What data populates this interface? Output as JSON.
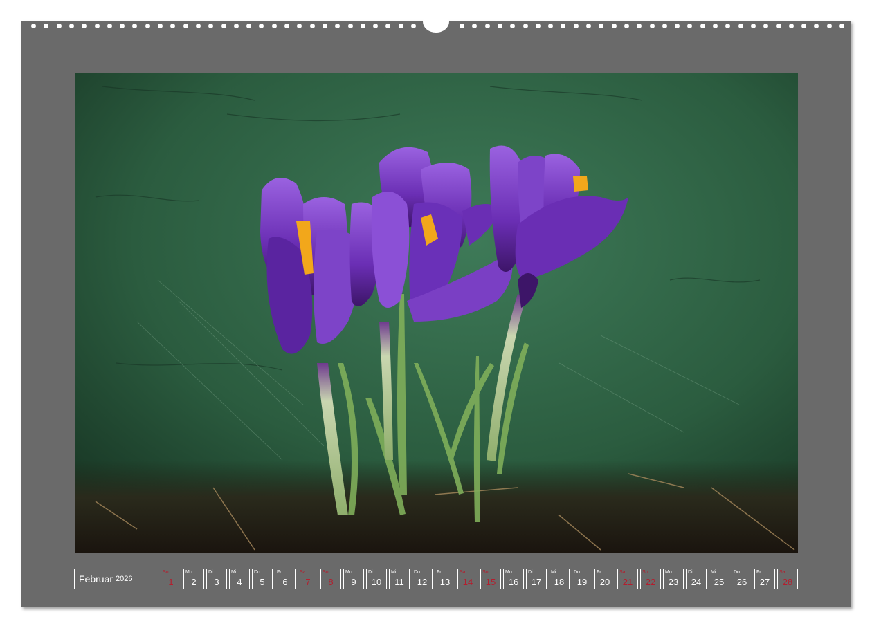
{
  "calendar": {
    "month": "Februar",
    "year": "2026",
    "days": [
      {
        "dow": "So",
        "num": "1",
        "weekend": true
      },
      {
        "dow": "Mo",
        "num": "2",
        "weekend": false
      },
      {
        "dow": "Di",
        "num": "3",
        "weekend": false
      },
      {
        "dow": "Mi",
        "num": "4",
        "weekend": false
      },
      {
        "dow": "Do",
        "num": "5",
        "weekend": false
      },
      {
        "dow": "Fr",
        "num": "6",
        "weekend": false
      },
      {
        "dow": "Sa",
        "num": "7",
        "weekend": true
      },
      {
        "dow": "So",
        "num": "8",
        "weekend": true
      },
      {
        "dow": "Mo",
        "num": "9",
        "weekend": false
      },
      {
        "dow": "Di",
        "num": "10",
        "weekend": false
      },
      {
        "dow": "Mi",
        "num": "11",
        "weekend": false
      },
      {
        "dow": "Do",
        "num": "12",
        "weekend": false
      },
      {
        "dow": "Fr",
        "num": "13",
        "weekend": false
      },
      {
        "dow": "Sa",
        "num": "14",
        "weekend": true
      },
      {
        "dow": "So",
        "num": "15",
        "weekend": true
      },
      {
        "dow": "Mo",
        "num": "16",
        "weekend": false
      },
      {
        "dow": "Di",
        "num": "17",
        "weekend": false
      },
      {
        "dow": "Mi",
        "num": "18",
        "weekend": false
      },
      {
        "dow": "Do",
        "num": "19",
        "weekend": false
      },
      {
        "dow": "Fr",
        "num": "20",
        "weekend": false
      },
      {
        "dow": "Sa",
        "num": "21",
        "weekend": true
      },
      {
        "dow": "So",
        "num": "22",
        "weekend": true
      },
      {
        "dow": "Mo",
        "num": "23",
        "weekend": false
      },
      {
        "dow": "Di",
        "num": "24",
        "weekend": false
      },
      {
        "dow": "Mi",
        "num": "25",
        "weekend": false
      },
      {
        "dow": "Do",
        "num": "26",
        "weekend": false
      },
      {
        "dow": "Fr",
        "num": "27",
        "weekend": false
      },
      {
        "dow": "Sa",
        "num": "28",
        "weekend": true
      }
    ]
  },
  "colors": {
    "sheet": "#6a6a6a",
    "weekend_text": "#b41e2e",
    "weekday_text": "#ffffff",
    "photo_background": "#2c5a3f",
    "crocus_petal": "#7a3fc4",
    "stamen": "#f2a71b"
  },
  "photo": {
    "subject_icon": "crocus-flowers-photo"
  }
}
